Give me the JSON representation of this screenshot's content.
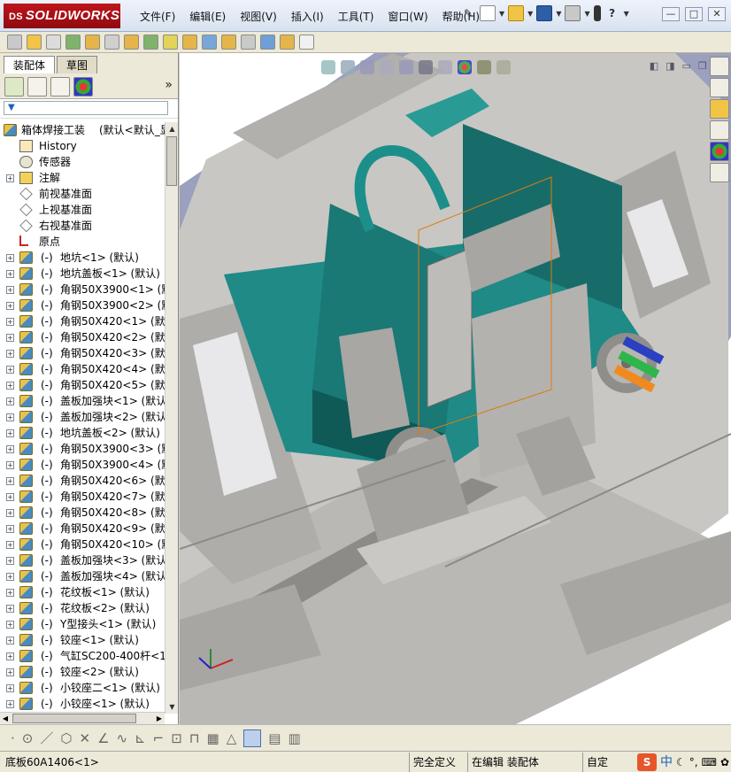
{
  "app": {
    "logo": "SOLIDWORKS",
    "logo_prefix": "DS"
  },
  "menu": [
    "文件(F)",
    "编辑(E)",
    "视图(V)",
    "插入(I)",
    "工具(T)",
    "窗口(W)",
    "帮助(H)"
  ],
  "window_controls": {
    "minimize": "—",
    "restore": "□",
    "close": "✕"
  },
  "panel": {
    "tabs": [
      "装配体",
      "草图"
    ],
    "expand_label": "»",
    "filter_placeholder": "▼"
  },
  "tree": {
    "root": {
      "label": "箱体焊接工装",
      "suffix": "(默认<默认_显"
    },
    "items": [
      {
        "type": "history",
        "label": "History"
      },
      {
        "type": "sensor",
        "label": "传感器"
      },
      {
        "type": "note",
        "label": "注解",
        "expand": "+"
      },
      {
        "type": "plane",
        "label": "前视基准面"
      },
      {
        "type": "plane",
        "label": "上视基准面"
      },
      {
        "type": "plane",
        "label": "右视基准面"
      },
      {
        "type": "origin",
        "label": "原点"
      }
    ],
    "components": [
      "地坑<1> (默认)",
      "地坑盖板<1> (默认)",
      "角钢50X3900<1> (默认",
      "角钢50X3900<2> (默认",
      "角钢50X420<1> (默认)",
      "角钢50X420<2> (默认)",
      "角钢50X420<3> (默认)",
      "角钢50X420<4> (默认)",
      "角钢50X420<5> (默认)",
      "盖板加强块<1> (默认)",
      "盖板加强块<2> (默认)",
      "地坑盖板<2> (默认)",
      "角钢50X3900<3> (默认",
      "角钢50X3900<4> (默认",
      "角钢50X420<6> (默认)",
      "角钢50X420<7> (默认)",
      "角钢50X420<8> (默认)",
      "角钢50X420<9> (默认)",
      "角钢50X420<10> (默认",
      "盖板加强块<3> (默认)",
      "盖板加强块<4> (默认)",
      "花纹板<1> (默认)",
      "花纹板<2> (默认)",
      "Y型接头<1> (默认)",
      "铰座<1> (默认)",
      "气缸SC200-400杆<1>",
      "铰座<2> (默认)",
      "小铰座二<1> (默认)",
      "小铰座<1> (默认)"
    ],
    "component_state": "(-)",
    "expand_symbol": "+"
  },
  "status": {
    "message": "底板60A1406<1>",
    "definition": "完全定义",
    "mode": "在编辑 装配体",
    "custom": "自定"
  },
  "ime": {
    "logo": "S",
    "lang": "中"
  },
  "colors": {
    "accent": "#c0141b",
    "teal": "#1f8a86",
    "metal": "#b8b8b8"
  }
}
